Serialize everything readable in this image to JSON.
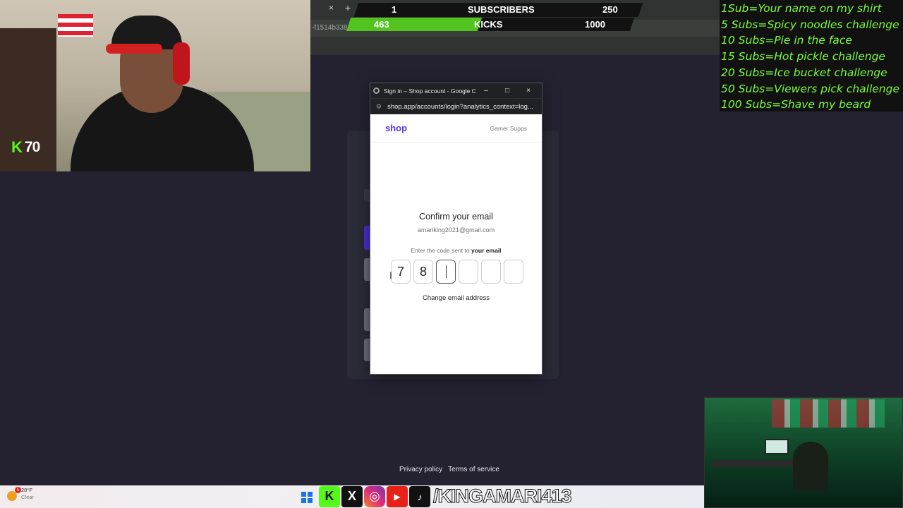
{
  "overlay": {
    "subscribers": {
      "current": "1",
      "label": "SUBSCRIBERS",
      "goal": "250"
    },
    "kicks": {
      "current": "463",
      "label": "KICKS",
      "goal": "1000",
      "progress": 0.463
    },
    "kick_count": "70",
    "goals": [
      "1Sub=Your name on my shirt",
      "5 Subs=Spicy noodles challenge",
      "10 Subs=Pie in the face",
      "15 Subs=Hot pickle challenge",
      "20 Subs=Ice bucket challenge",
      "50 Subs=Viewers pick challenge",
      "100 Subs=Shave my beard"
    ],
    "handle": "/KINGAMARI413",
    "social_icons": [
      "kick-icon",
      "x-icon",
      "instagram-icon",
      "youtube-icon",
      "tiktok-icon"
    ],
    "colors": {
      "kick_green": "#53fc18",
      "goal_text": "#7cfc3a"
    }
  },
  "background_browser": {
    "url_fragment": "-f1514b338aa8...652145%2Foauth%2Fauthorize%2Fclient_id%3D8c32c97a-ec87-4451-81cc",
    "tab_close": "×",
    "tab_new": "+"
  },
  "popup": {
    "window_title": "Sign in – Shop account - Google Chr...",
    "minimize": "–",
    "maximize": "□",
    "close": "×",
    "url": "shop.app/accounts/login?analytics_context=log...",
    "brand": "shop",
    "store": "Gamer Supps",
    "heading": "Confirm your email",
    "email": "amariking2021@gmail.com",
    "hint_prefix": "Enter the code sent to",
    "hint_bold": "your email",
    "code_digits": [
      "7",
      "8",
      "",
      "",
      "",
      ""
    ],
    "change_email": "Change email address"
  },
  "footer": {
    "privacy": "Privacy policy",
    "terms": "Terms of service"
  },
  "taskbar": {
    "weather_temp": "28°F",
    "weather_desc": "Clear",
    "weather_badge": "5"
  }
}
